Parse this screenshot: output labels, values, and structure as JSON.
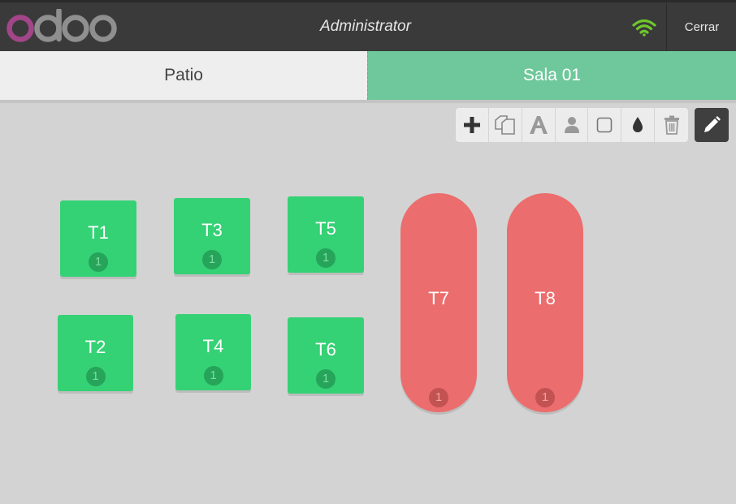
{
  "header": {
    "logo_text": "odoo",
    "user_name": "Administrator",
    "connection_icon": "wifi-icon",
    "close_label": "Cerrar",
    "colors": {
      "bar": "#3a3a3a",
      "logo_o": "#a24689",
      "logo_rest": "#8f8f8f",
      "wifi": "#6ec82c"
    }
  },
  "floors": [
    {
      "label": "Patio",
      "active": false
    },
    {
      "label": "Sala 01",
      "active": true
    }
  ],
  "toolbar": {
    "tools": [
      "add-icon",
      "duplicate-icon",
      "rename-icon",
      "seats-icon",
      "shape-icon",
      "color-icon",
      "trash-icon"
    ],
    "edit_icon": "pencil-icon"
  },
  "tables": [
    {
      "name": "T1",
      "seats": "1",
      "shape": "square",
      "color": "#35d175"
    },
    {
      "name": "T3",
      "seats": "1",
      "shape": "square",
      "color": "#35d175"
    },
    {
      "name": "T5",
      "seats": "1",
      "shape": "square",
      "color": "#35d175"
    },
    {
      "name": "T2",
      "seats": "1",
      "shape": "square",
      "color": "#35d175"
    },
    {
      "name": "T4",
      "seats": "1",
      "shape": "square",
      "color": "#35d175"
    },
    {
      "name": "T6",
      "seats": "1",
      "shape": "square",
      "color": "#35d175"
    },
    {
      "name": "T7",
      "seats": "1",
      "shape": "round",
      "color": "#eb6d6d"
    },
    {
      "name": "T8",
      "seats": "1",
      "shape": "round",
      "color": "#eb6d6d"
    }
  ]
}
